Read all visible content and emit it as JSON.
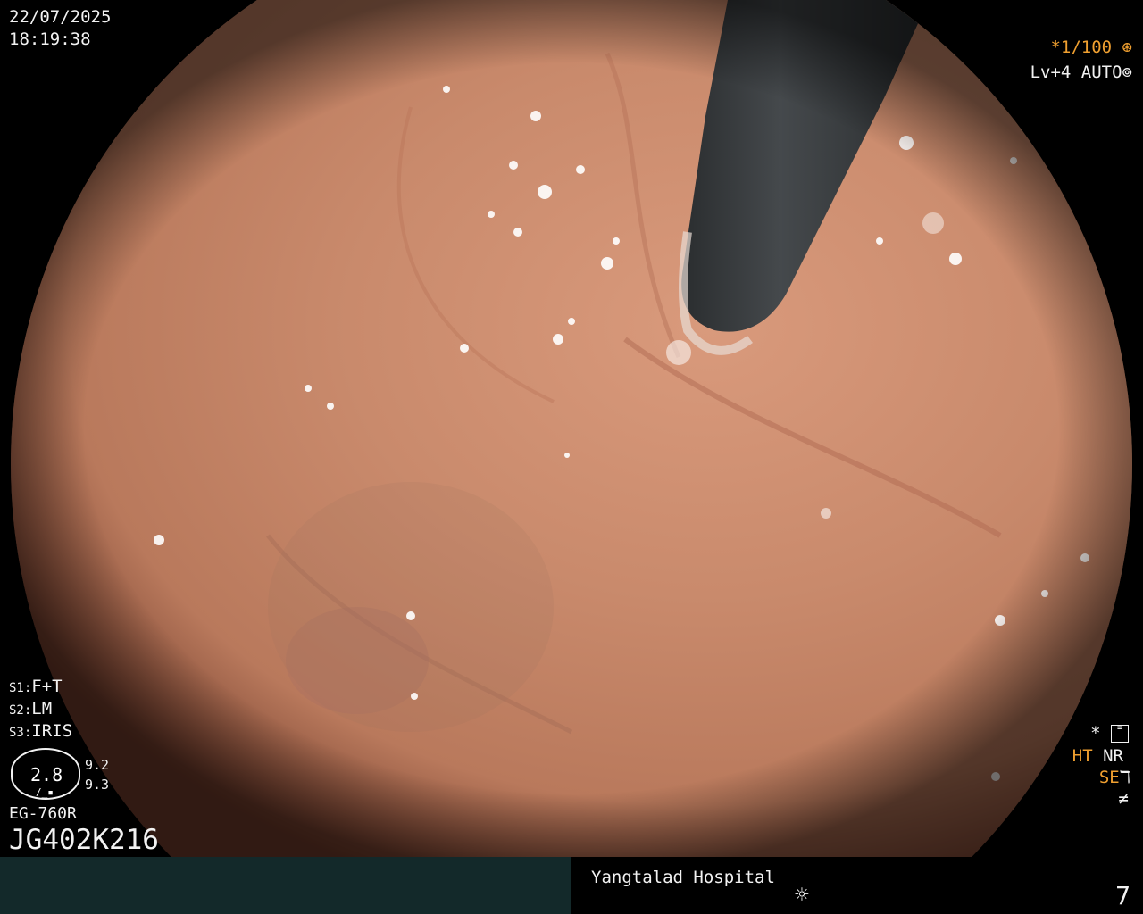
{
  "overlay": {
    "date": "22/07/2025",
    "time": "18:19:38",
    "shutter": "*1/100",
    "level": "Lv+4",
    "exposure_mode": "AUTO",
    "s1_label": "S1:",
    "s1_value": "F+T",
    "s2_label": "S2:",
    "s2_value": "LM",
    "s3_label": "S3:",
    "s3_value": "IRIS",
    "zoom_value": "2.8",
    "zoom_sub_a": "9.2",
    "zoom_sub_b": "9.3",
    "scope_model": "EG-760R",
    "serial": "JG402K216",
    "star": "*",
    "ht": "HT",
    "nr": "NR",
    "se": "SE"
  },
  "status": {
    "hospital": "Yangtalad Hospital",
    "index": "7"
  },
  "icons": [
    "shutter-icon",
    "iris-icon",
    "settings-icon",
    "gamma-icon",
    "filter-icon",
    "light-icon"
  ],
  "colors": {
    "overlay_text": "#f2f2f2",
    "accent": "#f0a030",
    "status_bar": "#13292a"
  }
}
